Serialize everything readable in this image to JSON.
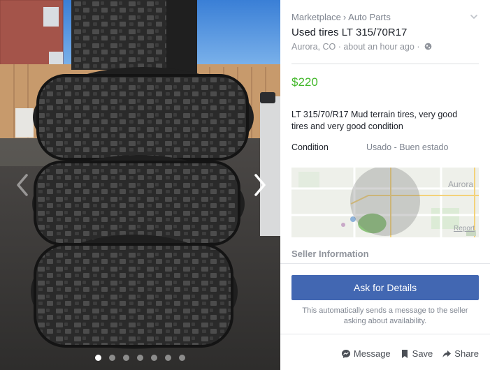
{
  "gallery": {
    "photo_count": 7,
    "active_index": 0
  },
  "listing": {
    "breadcrumb": [
      "Marketplace",
      "Auto Parts"
    ],
    "breadcrumb_separator": "›",
    "title": "Used tires LT 315/70R17",
    "location": "Aurora, CO",
    "posted": "about an hour ago",
    "meta_separator": "·",
    "price": "$220",
    "description": "LT 315/70/R17 Mud terrain tires, very good tires and  very good condition",
    "condition_label": "Condition",
    "condition_value": "Usado - Buen estado",
    "map_label": "Aurora",
    "map_report": "Report"
  },
  "seller": {
    "heading": "Seller Information",
    "ask_button": "Ask for Details",
    "note": "This automatically sends a message to the seller asking about availability."
  },
  "actions": {
    "message": "Message",
    "save": "Save",
    "share": "Share"
  },
  "icons": {
    "collapse": "chevron-down-icon",
    "privacy": "globe-icon",
    "prev": "chevron-left-icon",
    "next": "chevron-right-icon",
    "message": "messenger-icon",
    "save": "bookmark-icon",
    "share": "share-arrow-icon"
  },
  "colors": {
    "price": "#42b72a",
    "primary_button": "#4267b2",
    "secondary_text": "#90949c"
  }
}
